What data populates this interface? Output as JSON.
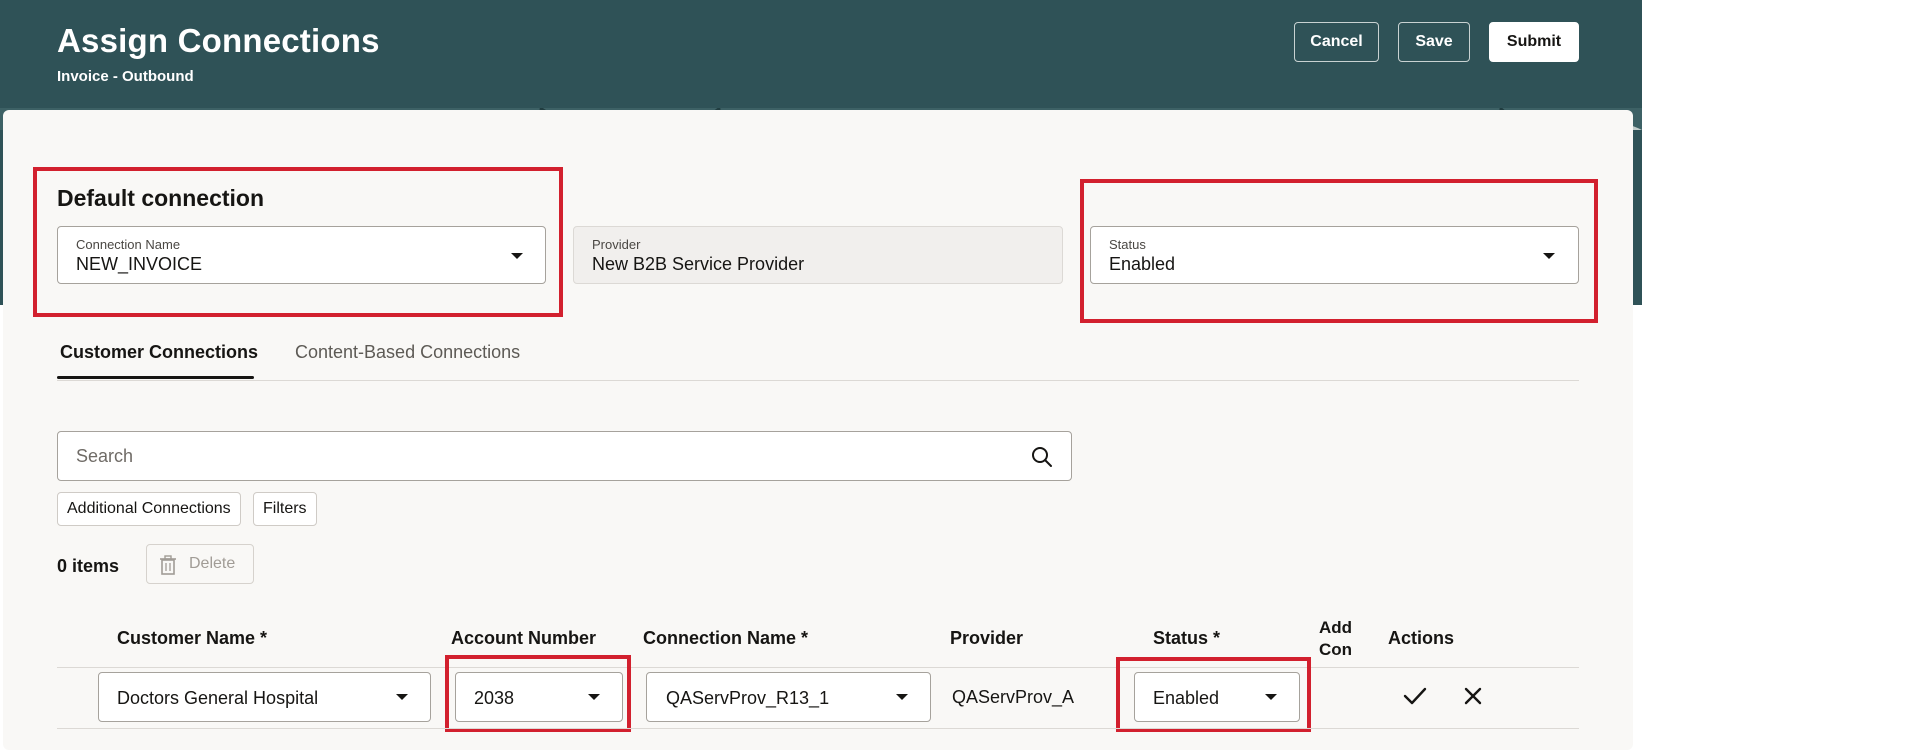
{
  "header": {
    "title": "Assign Connections",
    "subtitle": "Invoice - Outbound",
    "cancel_label": "Cancel",
    "save_label": "Save",
    "submit_label": "Submit"
  },
  "default_connection": {
    "section_title": "Default connection",
    "connection_name": {
      "label": "Connection Name",
      "value": "NEW_INVOICE",
      "icon": "chevron-down-icon"
    },
    "provider": {
      "label": "Provider",
      "value": "New B2B Service Provider"
    },
    "status": {
      "label": "Status",
      "value": "Enabled",
      "icon": "chevron-down-icon"
    }
  },
  "tabs": [
    {
      "label": "Customer Connections",
      "active": true
    },
    {
      "label": "Content-Based Connections",
      "active": false
    }
  ],
  "search": {
    "placeholder": "Search",
    "icon": "search-icon"
  },
  "toolbar": {
    "additional_connections_label": "Additional Connections",
    "filters_label": "Filters",
    "items_count": "0 items",
    "delete_label": "Delete",
    "delete_icon": "trash-icon"
  },
  "table": {
    "columns": [
      {
        "key": "customer_name",
        "label": "Customer Name *"
      },
      {
        "key": "account_number",
        "label": "Account Number"
      },
      {
        "key": "connection_name",
        "label": "Connection Name *"
      },
      {
        "key": "provider",
        "label": "Provider"
      },
      {
        "key": "status",
        "label": "Status *"
      },
      {
        "key": "additional",
        "label": "Add Con"
      },
      {
        "key": "actions",
        "label": "Actions"
      }
    ],
    "rows": [
      {
        "customer_name": "Doctors General Hospital",
        "account_number": "2038",
        "connection_name": "QAServProv_R13_1",
        "provider": "QAServProv_A",
        "status": "Enabled",
        "actions": [
          "check-icon",
          "close-icon"
        ]
      }
    ]
  },
  "colors": {
    "header_bg": "#2f5257",
    "card_bg": "#f9f8f6",
    "highlight": "#d2202e",
    "text": "#161513"
  }
}
